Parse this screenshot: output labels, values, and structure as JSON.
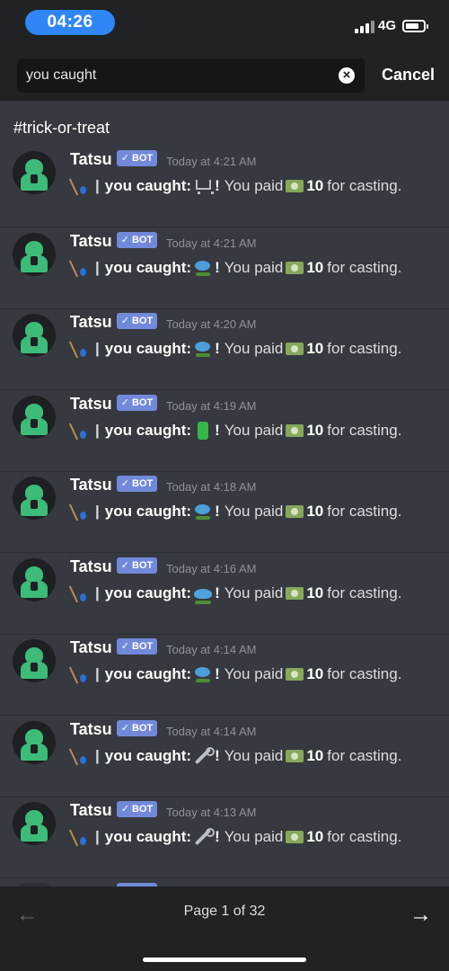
{
  "status_bar": {
    "time": "04:26",
    "network": "4G"
  },
  "search": {
    "query": "you caught",
    "cancel_label": "Cancel"
  },
  "channel": "#trick-or-treat",
  "messages": [
    {
      "author": "Tatsu",
      "tag": "✓ BOT",
      "timestamp": "Today at 4:21 AM",
      "prefix": "|",
      "caught_label": "you caught:",
      "item_icon": "shopping-cart-icon",
      "exclaim": "!",
      "paid_text": "You paid",
      "amount": "10",
      "suffix": "for casting."
    },
    {
      "author": "Tatsu",
      "tag": "✓ BOT",
      "timestamp": "Today at 4:21 AM",
      "prefix": "|",
      "caught_label": "you caught:",
      "item_icon": "fish-icon",
      "exclaim": "!",
      "paid_text": "You paid",
      "amount": "10",
      "suffix": "for casting."
    },
    {
      "author": "Tatsu",
      "tag": "✓ BOT",
      "timestamp": "Today at 4:20 AM",
      "prefix": "|",
      "caught_label": "you caught:",
      "item_icon": "fish-icon",
      "exclaim": "!",
      "paid_text": "You paid",
      "amount": "10",
      "suffix": "for casting."
    },
    {
      "author": "Tatsu",
      "tag": "✓ BOT",
      "timestamp": "Today at 4:19 AM",
      "prefix": "|",
      "caught_label": "you caught:",
      "item_icon": "battery-icon",
      "exclaim": "!",
      "paid_text": "You paid",
      "amount": "10",
      "suffix": "for casting."
    },
    {
      "author": "Tatsu",
      "tag": "✓ BOT",
      "timestamp": "Today at 4:18 AM",
      "prefix": "|",
      "caught_label": "you caught:",
      "item_icon": "fish-icon",
      "exclaim": "!",
      "paid_text": "You paid",
      "amount": "10",
      "suffix": "for casting."
    },
    {
      "author": "Tatsu",
      "tag": "✓ BOT",
      "timestamp": "Today at 4:16 AM",
      "prefix": "|",
      "caught_label": "you caught:",
      "item_icon": "whale-icon",
      "exclaim": "!",
      "paid_text": "You paid",
      "amount": "10",
      "suffix": "for casting."
    },
    {
      "author": "Tatsu",
      "tag": "✓ BOT",
      "timestamp": "Today at 4:14 AM",
      "prefix": "|",
      "caught_label": "you caught:",
      "item_icon": "fish-icon",
      "exclaim": "!",
      "paid_text": "You paid",
      "amount": "10",
      "suffix": "for casting."
    },
    {
      "author": "Tatsu",
      "tag": "✓ BOT",
      "timestamp": "Today at 4:14 AM",
      "prefix": "|",
      "caught_label": "you caught:",
      "item_icon": "wrench-icon",
      "exclaim": "!",
      "paid_text": "You paid",
      "amount": "10",
      "suffix": "for casting."
    },
    {
      "author": "Tatsu",
      "tag": "✓ BOT",
      "timestamp": "Today at 4:13 AM",
      "prefix": "|",
      "caught_label": "you caught:",
      "item_icon": "wrench-icon",
      "exclaim": "!",
      "paid_text": "You paid",
      "amount": "10",
      "suffix": "for casting."
    }
  ],
  "pagination": {
    "label": "Page 1 of 32",
    "prev_icon": "arrow-left-icon",
    "next_icon": "arrow-right-icon"
  },
  "colors": {
    "background": "#36393f",
    "header": "#202225",
    "bot_tag": "#7289da",
    "accent_time": "#2f87f5"
  }
}
